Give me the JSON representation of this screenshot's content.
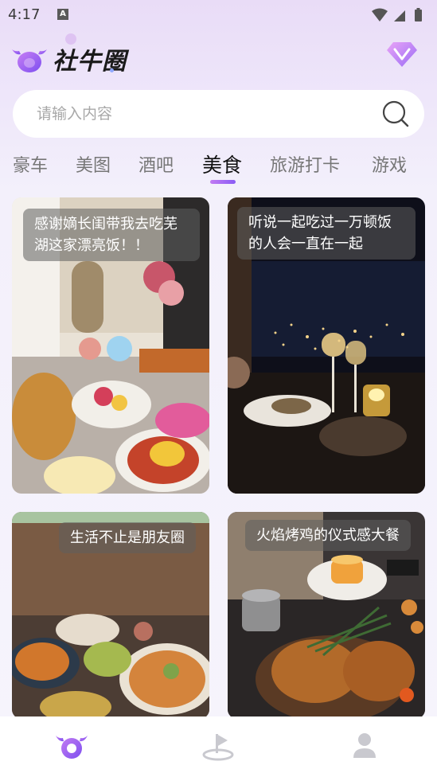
{
  "status_bar": {
    "time": "4:17",
    "notification_letter": "A"
  },
  "header": {
    "app_title": "社牛圈"
  },
  "search": {
    "placeholder": "请输入内容",
    "value": ""
  },
  "tabs": [
    {
      "label": "豪车",
      "active": false
    },
    {
      "label": "美图",
      "active": false
    },
    {
      "label": "酒吧",
      "active": false
    },
    {
      "label": "美食",
      "active": true
    },
    {
      "label": "旅游打卡",
      "active": false
    },
    {
      "label": "游戏",
      "active": false
    }
  ],
  "cards": [
    {
      "caption": "感谢嫡长闺带我去吃芜湖这家漂亮饭！！"
    },
    {
      "caption": "听说一起吃过一万顿饭的人会一直在一起"
    },
    {
      "caption": "生活不止是朋友圈"
    },
    {
      "caption": "火焰烤鸡的仪式感大餐"
    }
  ],
  "colors": {
    "accent": "#9b5cf0",
    "tab_active": "#111111",
    "tab_inactive": "#777777"
  },
  "bottom_nav": [
    {
      "icon": "bull-icon",
      "active": true
    },
    {
      "icon": "planet-icon",
      "active": false
    },
    {
      "icon": "profile-icon",
      "active": false
    }
  ]
}
